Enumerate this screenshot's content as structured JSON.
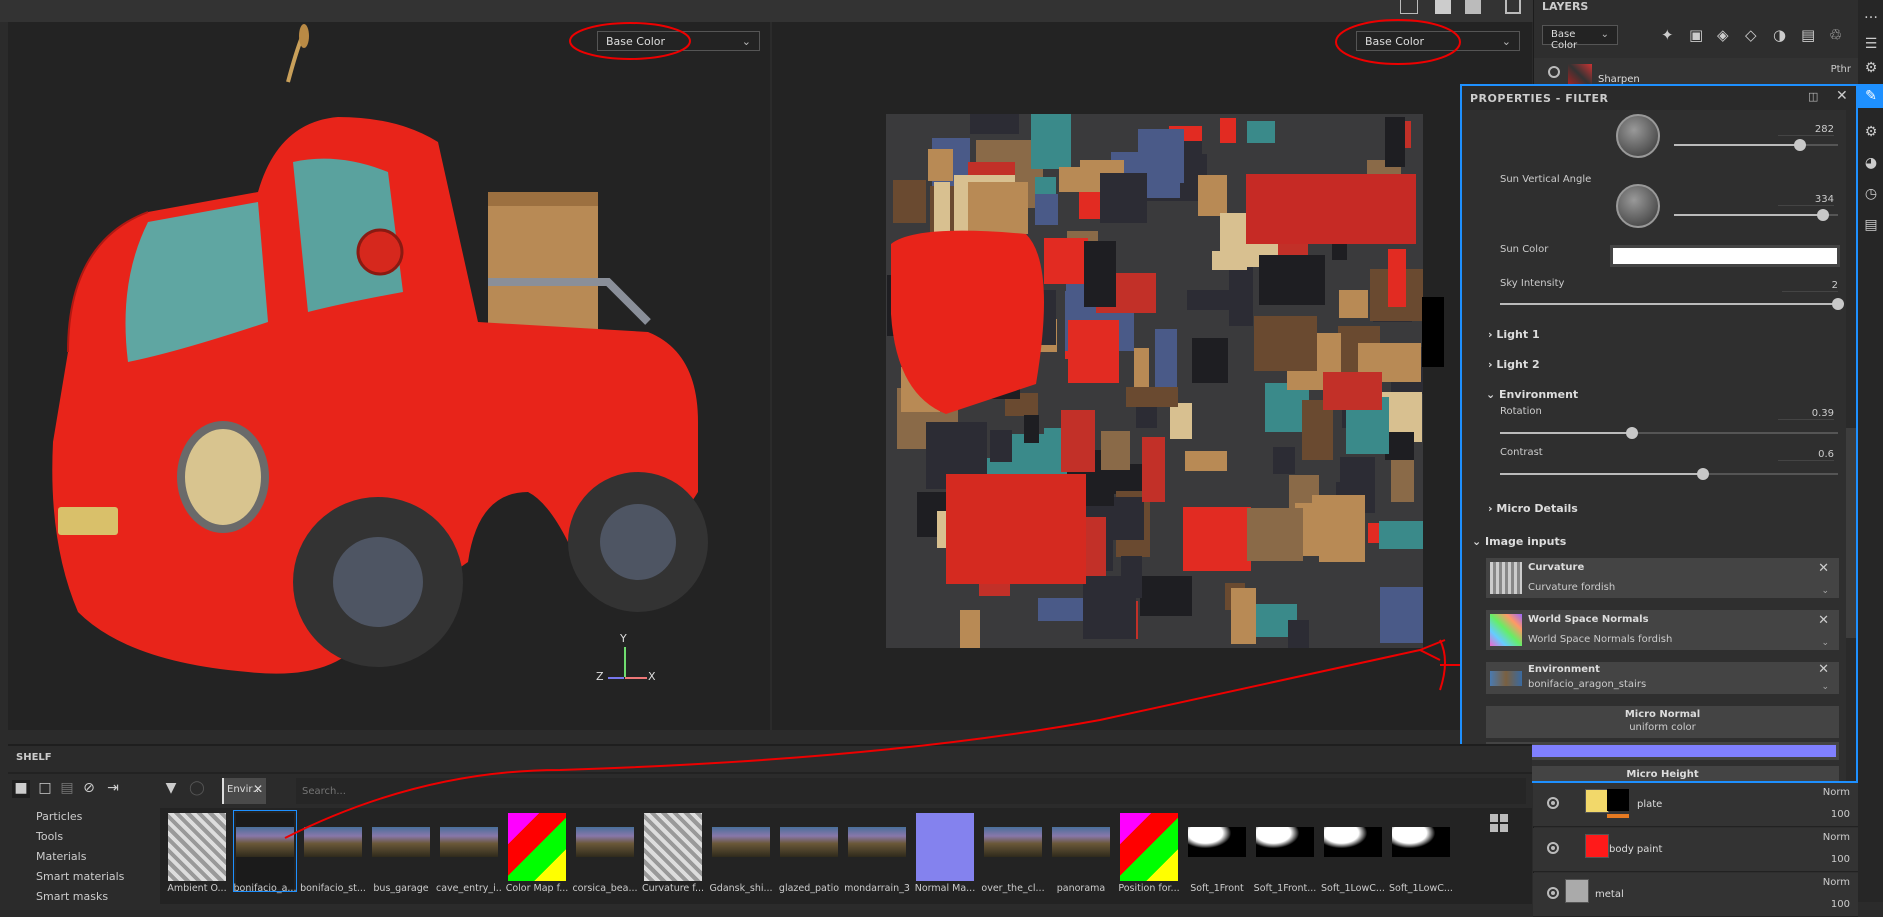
{
  "viewport_left": {
    "channel": "Base Color",
    "axes": {
      "x": "X",
      "y": "Y",
      "z": "Z"
    }
  },
  "viewport_right": {
    "channel": "Base Color"
  },
  "layers": {
    "title": "LAYERS",
    "channel": "Base Color",
    "toolbar_icons": [
      "magic-wand-icon",
      "mask-icon",
      "add-layer-icon",
      "add-fill-icon",
      "add-effect-icon",
      "add-folder-icon",
      "trash-icon"
    ],
    "rows": [
      {
        "name": "Sharpen",
        "blend": "Pthr",
        "opacity": ""
      },
      {
        "name": "plate",
        "blend": "Norm",
        "opacity": "100",
        "color": "#f2d86a"
      },
      {
        "name": "body paint",
        "blend": "Norm",
        "opacity": "100",
        "color": "#ff1a1a"
      },
      {
        "name": "metal",
        "blend": "Norm",
        "opacity": "100",
        "color": "#aaaaaa"
      }
    ]
  },
  "properties": {
    "title": "PROPERTIES - FILTER",
    "sun_horizontal": {
      "value": "282",
      "fraction": 0.77
    },
    "sun_vertical": {
      "label": "Sun Vertical Angle",
      "value": "334",
      "fraction": 0.91
    },
    "sun_color": {
      "label": "Sun Color",
      "color": "#ffffff"
    },
    "sky_intensity": {
      "label": "Sky Intensity",
      "value": "2",
      "fraction": 1.0
    },
    "sections": {
      "light1": "Light 1",
      "light2": "Light 2",
      "environment": "Environment",
      "micro_details": "Micro Details",
      "image_inputs": "Image inputs"
    },
    "rotation": {
      "label": "Rotation",
      "value": "0.39",
      "fraction": 0.39
    },
    "contrast": {
      "label": "Contrast",
      "value": "0.6",
      "fraction": 0.6
    },
    "inputs": [
      {
        "title": "Curvature",
        "value": "Curvature fordish"
      },
      {
        "title": "World Space Normals",
        "value": "World Space Normals fordish"
      },
      {
        "title": "Environment",
        "value": "bonifacio_aragon_stairs"
      }
    ],
    "micro_normal": {
      "title": "Micro Normal",
      "value": "uniform color",
      "color": "#8080ff"
    },
    "micro_height": {
      "title": "Micro Height"
    }
  },
  "shelf": {
    "title": "SHELF",
    "filter_tag": "Envir…",
    "search_placeholder": "Search...",
    "categories": [
      "Particles",
      "Tools",
      "Materials",
      "Smart materials",
      "Smart masks"
    ],
    "items": [
      {
        "label": "Ambient O...",
        "kind": "square-gray"
      },
      {
        "label": "bonifacio_a...",
        "kind": "hdri",
        "selected": true
      },
      {
        "label": "bonifacio_st...",
        "kind": "hdri"
      },
      {
        "label": "bus_garage",
        "kind": "hdri"
      },
      {
        "label": "cave_entry_i...",
        "kind": "hdri"
      },
      {
        "label": "Color Map f...",
        "kind": "square-color"
      },
      {
        "label": "corsica_bea...",
        "kind": "hdri"
      },
      {
        "label": "Curvature f...",
        "kind": "square-gray"
      },
      {
        "label": "Gdansk_shi...",
        "kind": "hdri"
      },
      {
        "label": "glazed_patio",
        "kind": "hdri"
      },
      {
        "label": "mondarrain_3",
        "kind": "hdri"
      },
      {
        "label": "Normal Ma...",
        "kind": "square-normal"
      },
      {
        "label": "over_the_cl...",
        "kind": "hdri"
      },
      {
        "label": "panorama",
        "kind": "hdri"
      },
      {
        "label": "Position for...",
        "kind": "square-color"
      },
      {
        "label": "Soft_1Front",
        "kind": "light"
      },
      {
        "label": "Soft_1Front...",
        "kind": "light"
      },
      {
        "label": "Soft_1LowC...",
        "kind": "light"
      },
      {
        "label": "Soft_1LowC...",
        "kind": "light"
      }
    ]
  },
  "colors": {
    "accent": "#1e90ff",
    "annotation": "#e00000"
  }
}
